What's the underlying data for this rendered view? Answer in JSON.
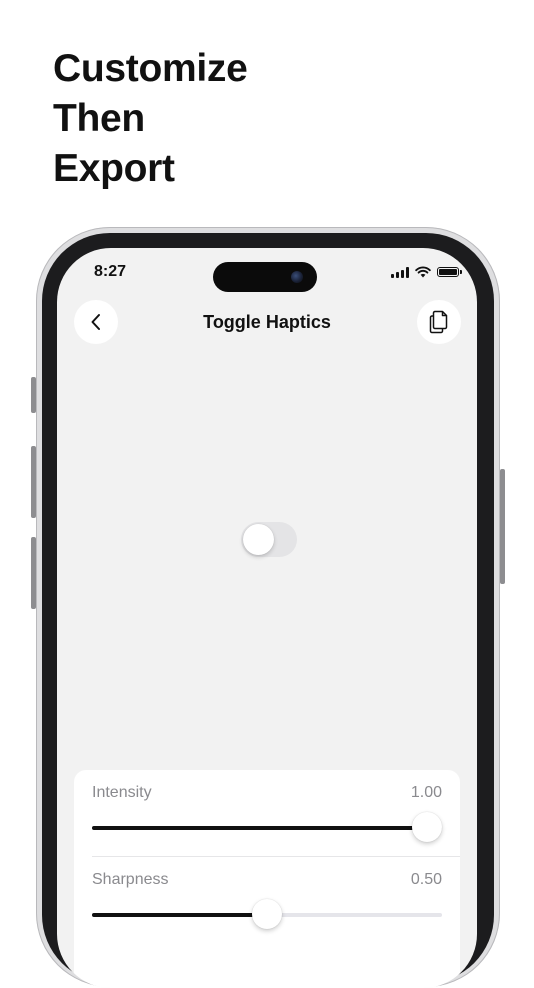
{
  "headline": [
    "Customize",
    "Then",
    "Export"
  ],
  "status_bar": {
    "time": "8:27"
  },
  "nav": {
    "title": "Toggle Haptics",
    "back_icon": "chevron-left-icon",
    "copy_icon": "copy-documents-icon"
  },
  "toggle": {
    "state": "off"
  },
  "sliders": [
    {
      "label": "Intensity",
      "value": "1.00",
      "fraction": 1.0
    },
    {
      "label": "Sharpness",
      "value": "0.50",
      "fraction": 0.5
    }
  ]
}
